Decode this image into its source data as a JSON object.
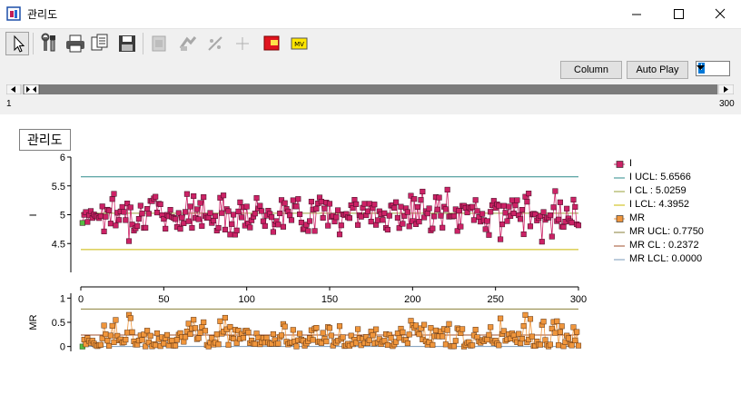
{
  "window": {
    "title": "관리도"
  },
  "toolbar": {
    "buttons": [
      {
        "name": "pointer-icon",
        "enabled": true
      },
      {
        "name": "properties-icon",
        "enabled": true
      },
      {
        "name": "print-icon",
        "enabled": true
      },
      {
        "name": "copy-icon",
        "enabled": true
      },
      {
        "name": "save-icon",
        "enabled": true
      },
      {
        "name": "disabled-tool-1-icon",
        "enabled": false
      },
      {
        "name": "disabled-tool-2-icon",
        "enabled": false
      },
      {
        "name": "disabled-tool-3-icon",
        "enabled": false
      },
      {
        "name": "disabled-tool-4-icon",
        "enabled": false
      },
      {
        "name": "red-marker-icon",
        "enabled": true
      },
      {
        "name": "yellow-marker-icon",
        "enabled": true
      }
    ]
  },
  "controls": {
    "column_label": "Column",
    "autoplay_label": "Auto Play",
    "select_value": "I",
    "range_start": "1",
    "range_end": "300"
  },
  "chart": {
    "box_title": "관리도",
    "legend": [
      {
        "label": "I",
        "kind": "marker",
        "color": "#cc2266"
      },
      {
        "label": "I UCL: 5.6566",
        "kind": "line",
        "color": "#2e8b8b"
      },
      {
        "label": "I CL : 5.0259",
        "kind": "line",
        "color": "#9aa23a"
      },
      {
        "label": "I LCL: 4.3952",
        "kind": "line",
        "color": "#c9b800"
      },
      {
        "label": "MR",
        "kind": "marker",
        "color": "#f0963c"
      },
      {
        "label": "MR UCL: 0.7750",
        "kind": "line",
        "color": "#8a7f3a"
      },
      {
        "label": "MR CL : 0.2372",
        "kind": "line",
        "color": "#a0522d"
      },
      {
        "label": "MR LCL: 0.0000",
        "kind": "line",
        "color": "#7a9ab8"
      }
    ]
  },
  "chart_data": [
    {
      "type": "line",
      "title": "",
      "xlabel": "",
      "ylabel": "I",
      "xlim": [
        0,
        300
      ],
      "ylim": [
        4,
        6
      ],
      "yticks": [
        "4.5",
        "5",
        "5.5",
        "6"
      ],
      "control_limits": {
        "ucl": 5.6566,
        "cl": 5.0259,
        "lcl": 4.3952
      },
      "series": [
        {
          "name": "I",
          "color": "#cc2266",
          "seed": 7,
          "n": 300,
          "mean": 5.0259,
          "spread": 0.22
        }
      ]
    },
    {
      "type": "line",
      "title": "",
      "xlabel": "",
      "ylabel": "MR",
      "xlim": [
        0,
        300
      ],
      "xticks": [
        "0",
        "50",
        "100",
        "150",
        "200",
        "250",
        "300"
      ],
      "ylim": [
        -0.1,
        1.1
      ],
      "yticks": [
        "0",
        "0.5",
        "1"
      ],
      "control_limits": {
        "ucl": 0.775,
        "cl": 0.2372,
        "lcl": 0.0
      },
      "series": [
        {
          "name": "MR",
          "color": "#f0963c",
          "derived_from": "I"
        }
      ]
    }
  ]
}
